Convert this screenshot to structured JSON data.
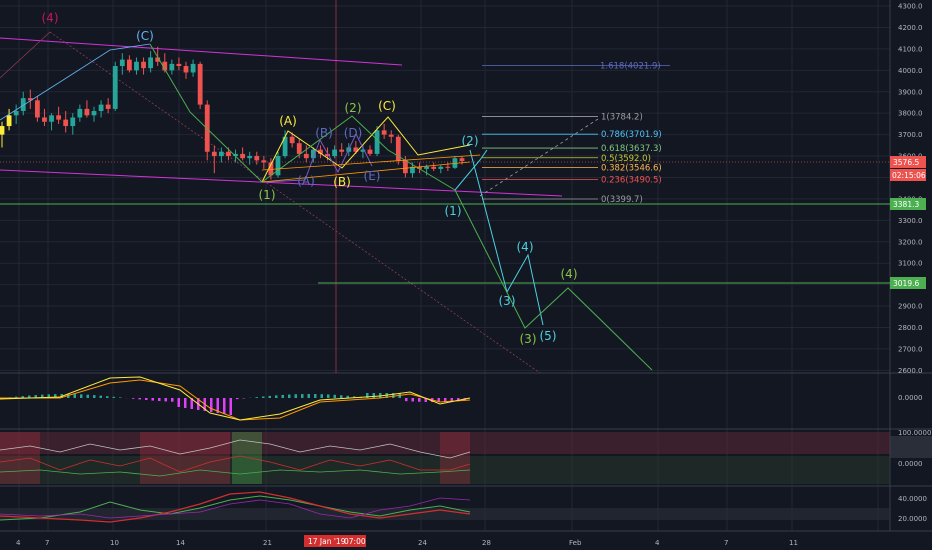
{
  "colors": {
    "bg": "#131722",
    "grid": "#232735",
    "up": "#26a69a",
    "down": "#ef5350",
    "yellow": "#ffeb3b",
    "channel": "#d333d8",
    "green": "#4caf50",
    "cyan": "#4dd0e1",
    "orange": "#ff9800",
    "purple": "#7e57c2",
    "gray": "#787b86"
  },
  "chart_data": {
    "type": "candlestick",
    "title": "",
    "x_ticks": [
      "4",
      "7",
      "10",
      "14",
      "17 Jan '19",
      "21",
      "24",
      "28",
      "Feb",
      "4",
      "7",
      "11"
    ],
    "crosshair": {
      "date": "17 Jan '19",
      "time": "07:00"
    },
    "price_axis_ticks": [
      2600,
      2700,
      2800,
      2900,
      3000,
      3100,
      3200,
      3300,
      3400,
      3500,
      3600,
      3700,
      3800,
      3900,
      4000,
      4100,
      4200,
      4300
    ],
    "price_tags": {
      "last": "3576.5",
      "countdown": "02:15:06",
      "support": "3381.3",
      "target": "3019.6"
    },
    "candles": [
      {
        "o": 3700,
        "h": 3760,
        "l": 3640,
        "c": 3740
      },
      {
        "o": 3740,
        "h": 3820,
        "l": 3720,
        "c": 3790
      },
      {
        "o": 3790,
        "h": 3840,
        "l": 3750,
        "c": 3810
      },
      {
        "o": 3810,
        "h": 3900,
        "l": 3790,
        "c": 3870
      },
      {
        "o": 3870,
        "h": 3910,
        "l": 3820,
        "c": 3860
      },
      {
        "o": 3860,
        "h": 3880,
        "l": 3760,
        "c": 3780
      },
      {
        "o": 3780,
        "h": 3820,
        "l": 3740,
        "c": 3760
      },
      {
        "o": 3760,
        "h": 3800,
        "l": 3720,
        "c": 3790
      },
      {
        "o": 3790,
        "h": 3830,
        "l": 3750,
        "c": 3770
      },
      {
        "o": 3770,
        "h": 3810,
        "l": 3710,
        "c": 3740
      },
      {
        "o": 3740,
        "h": 3800,
        "l": 3700,
        "c": 3780
      },
      {
        "o": 3780,
        "h": 3840,
        "l": 3760,
        "c": 3820
      },
      {
        "o": 3820,
        "h": 3860,
        "l": 3780,
        "c": 3790
      },
      {
        "o": 3790,
        "h": 3830,
        "l": 3760,
        "c": 3810
      },
      {
        "o": 3810,
        "h": 3860,
        "l": 3780,
        "c": 3840
      },
      {
        "o": 3840,
        "h": 3870,
        "l": 3800,
        "c": 3820
      },
      {
        "o": 3820,
        "h": 4040,
        "l": 3810,
        "c": 4020
      },
      {
        "o": 4020,
        "h": 4080,
        "l": 3980,
        "c": 4050
      },
      {
        "o": 4050,
        "h": 4070,
        "l": 3990,
        "c": 4000
      },
      {
        "o": 4000,
        "h": 4060,
        "l": 3980,
        "c": 4040
      },
      {
        "o": 4040,
        "h": 4060,
        "l": 3980,
        "c": 4010
      },
      {
        "o": 4010,
        "h": 4090,
        "l": 3990,
        "c": 4060
      },
      {
        "o": 4060,
        "h": 4110,
        "l": 4020,
        "c": 4040
      },
      {
        "o": 4040,
        "h": 4080,
        "l": 3990,
        "c": 4000
      },
      {
        "o": 4000,
        "h": 4050,
        "l": 3980,
        "c": 4030
      },
      {
        "o": 4030,
        "h": 4060,
        "l": 4000,
        "c": 4020
      },
      {
        "o": 4020,
        "h": 4040,
        "l": 3960,
        "c": 3990
      },
      {
        "o": 3990,
        "h": 4050,
        "l": 3970,
        "c": 4030
      },
      {
        "o": 4030,
        "h": 4040,
        "l": 3820,
        "c": 3840
      },
      {
        "o": 3840,
        "h": 3860,
        "l": 3580,
        "c": 3620
      },
      {
        "o": 3620,
        "h": 3650,
        "l": 3520,
        "c": 3600
      },
      {
        "o": 3600,
        "h": 3640,
        "l": 3570,
        "c": 3620
      },
      {
        "o": 3620,
        "h": 3640,
        "l": 3580,
        "c": 3600
      },
      {
        "o": 3600,
        "h": 3630,
        "l": 3570,
        "c": 3610
      },
      {
        "o": 3610,
        "h": 3640,
        "l": 3580,
        "c": 3590
      },
      {
        "o": 3590,
        "h": 3620,
        "l": 3560,
        "c": 3600
      },
      {
        "o": 3600,
        "h": 3620,
        "l": 3560,
        "c": 3580
      },
      {
        "o": 3580,
        "h": 3600,
        "l": 3540,
        "c": 3570
      },
      {
        "o": 3570,
        "h": 3590,
        "l": 3490,
        "c": 3510
      },
      {
        "o": 3510,
        "h": 3620,
        "l": 3500,
        "c": 3600
      },
      {
        "o": 3600,
        "h": 3720,
        "l": 3590,
        "c": 3690
      },
      {
        "o": 3690,
        "h": 3710,
        "l": 3640,
        "c": 3660
      },
      {
        "o": 3660,
        "h": 3680,
        "l": 3590,
        "c": 3610
      },
      {
        "o": 3610,
        "h": 3650,
        "l": 3570,
        "c": 3590
      },
      {
        "o": 3590,
        "h": 3640,
        "l": 3570,
        "c": 3630
      },
      {
        "o": 3630,
        "h": 3650,
        "l": 3590,
        "c": 3610
      },
      {
        "o": 3610,
        "h": 3640,
        "l": 3580,
        "c": 3600
      },
      {
        "o": 3600,
        "h": 3650,
        "l": 3590,
        "c": 3630
      },
      {
        "o": 3630,
        "h": 3660,
        "l": 3600,
        "c": 3620
      },
      {
        "o": 3620,
        "h": 3660,
        "l": 3600,
        "c": 3640
      },
      {
        "o": 3640,
        "h": 3670,
        "l": 3610,
        "c": 3620
      },
      {
        "o": 3620,
        "h": 3650,
        "l": 3590,
        "c": 3630
      },
      {
        "o": 3630,
        "h": 3650,
        "l": 3600,
        "c": 3610
      },
      {
        "o": 3610,
        "h": 3740,
        "l": 3600,
        "c": 3720
      },
      {
        "o": 3720,
        "h": 3750,
        "l": 3680,
        "c": 3700
      },
      {
        "o": 3700,
        "h": 3720,
        "l": 3660,
        "c": 3690
      },
      {
        "o": 3690,
        "h": 3700,
        "l": 3560,
        "c": 3580
      },
      {
        "o": 3580,
        "h": 3600,
        "l": 3500,
        "c": 3520
      },
      {
        "o": 3520,
        "h": 3570,
        "l": 3500,
        "c": 3550
      },
      {
        "o": 3550,
        "h": 3570,
        "l": 3520,
        "c": 3540
      },
      {
        "o": 3540,
        "h": 3560,
        "l": 3510,
        "c": 3550
      },
      {
        "o": 3550,
        "h": 3570,
        "l": 3530,
        "c": 3540
      },
      {
        "o": 3540,
        "h": 3560,
        "l": 3520,
        "c": 3550
      },
      {
        "o": 3550,
        "h": 3570,
        "l": 3530,
        "c": 3545
      },
      {
        "o": 3545,
        "h": 3600,
        "l": 3540,
        "c": 3590
      },
      {
        "o": 3590,
        "h": 3600,
        "l": 3560,
        "c": 3576.5
      }
    ],
    "fibonacci": [
      {
        "label": "1.618(4021.9)",
        "value": 4021.9,
        "color": "#5c6bc0"
      },
      {
        "label": "1(3784.2)",
        "value": 3784.2,
        "color": "#9e9e9e"
      },
      {
        "label": "0.786(3701.9)",
        "value": 3701.9,
        "color": "#4fc3f7"
      },
      {
        "label": "0.618(3637.3)",
        "value": 3637.3,
        "color": "#81c784"
      },
      {
        "label": "0.5(3592.0)",
        "value": 3592.0,
        "color": "#c0ca33"
      },
      {
        "label": "0.382(3546.6)",
        "value": 3546.6,
        "color": "#ffb74d"
      },
      {
        "label": "0.236(3490.5)",
        "value": 3490.5,
        "color": "#ef5350"
      },
      {
        "label": "0(3399.7)",
        "value": 3399.7,
        "color": "#9e9e9e"
      }
    ],
    "wave_labels": [
      {
        "text": "(4)",
        "color": "#c2185b"
      },
      {
        "text": "(C)",
        "color": "#64b5f6"
      },
      {
        "text": "(A)",
        "color": "#ffeb3b"
      },
      {
        "text": "(B)",
        "color": "#5c6bc0"
      },
      {
        "text": "(D)",
        "color": "#5c6bc0"
      },
      {
        "text": "(A)",
        "color": "#5c6bc0"
      },
      {
        "text": "(B)",
        "color": "#ffeb3b"
      },
      {
        "text": "(E)",
        "color": "#5c6bc0"
      },
      {
        "text": "(2)",
        "color": "#8bc34a"
      },
      {
        "text": "(C)",
        "color": "#ffeb3b"
      },
      {
        "text": "(1)",
        "color": "#8bc34a"
      },
      {
        "text": "(1)",
        "color": "#4dd0e1"
      },
      {
        "text": "(2)",
        "color": "#4dd0e1"
      },
      {
        "text": "(3)",
        "color": "#4dd0e1"
      },
      {
        "text": "(4)",
        "color": "#4dd0e1"
      },
      {
        "text": "(5)",
        "color": "#4dd0e1"
      },
      {
        "text": "(3)",
        "color": "#8bc34a"
      },
      {
        "text": "(4)",
        "color": "#8bc34a"
      }
    ],
    "indicator_panes": [
      {
        "axis_labels": [
          "0.0000"
        ]
      },
      {
        "axis_labels": [
          "100.0000",
          "0.0000"
        ]
      },
      {
        "axis_labels": [
          "40.0000",
          "20.0000"
        ]
      }
    ]
  }
}
